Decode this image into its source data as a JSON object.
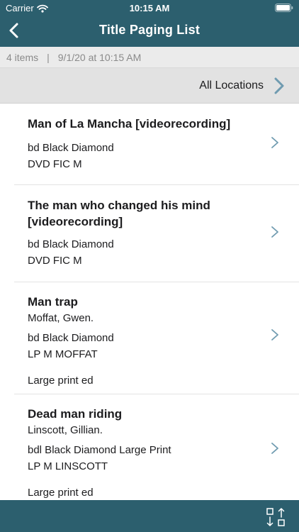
{
  "status": {
    "carrier": "Carrier",
    "time": "10:15 AM"
  },
  "nav": {
    "title": "Title Paging List"
  },
  "meta": {
    "count": "4 items",
    "separator": "|",
    "timestamp": "9/1/20 at 10:15 AM"
  },
  "location": {
    "label": "All Locations"
  },
  "items": [
    {
      "title": "Man of La Mancha [videorecording]",
      "location": "bd Black Diamond",
      "call_number": "DVD FIC M"
    },
    {
      "title": "The man who changed his mind [videorecording]",
      "location": "bd Black Diamond",
      "call_number": "DVD FIC M"
    },
    {
      "title": "Man trap",
      "author": "Moffat, Gwen.",
      "location": "bd Black Diamond",
      "call_number": "LP M MOFFAT",
      "edition": "Large print ed"
    },
    {
      "title": "Dead man riding",
      "author": "Linscott, Gillian.",
      "location": "bdl Black Diamond Large Print",
      "call_number": "LP M LINSCOTT",
      "edition": "Large print ed"
    }
  ],
  "colors": {
    "bar": "#2c5f6e",
    "meta_bg": "#ebebeb",
    "location_bg": "#e2e2e2",
    "chevron": "#6f9bb0"
  }
}
